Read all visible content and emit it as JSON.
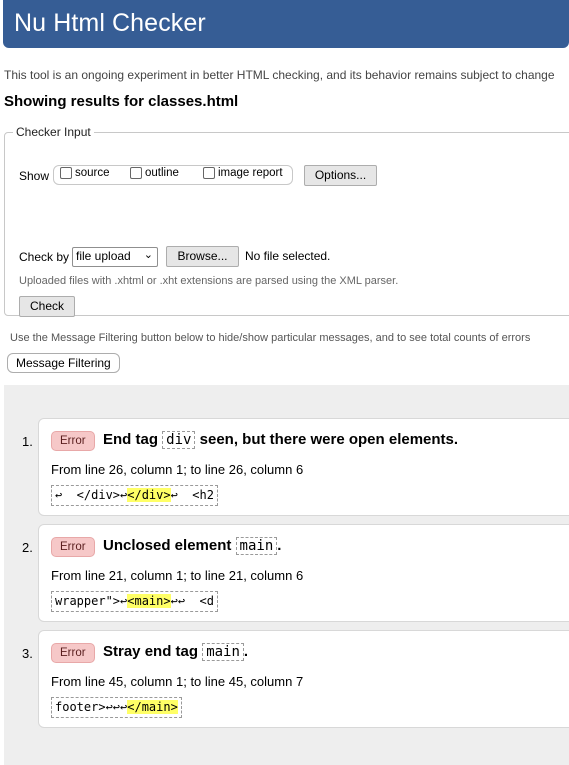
{
  "app_title": "Nu Html Checker",
  "tagline": "This tool is an ongoing experiment in better HTML checking, and its behavior remains subject to change",
  "showing": "Showing results for classes.html",
  "checker_input": {
    "legend": "Checker Input",
    "show_label": "Show",
    "show_options": [
      {
        "label": "source",
        "checked": false
      },
      {
        "label": "outline",
        "checked": false
      },
      {
        "label": "image report",
        "checked": false
      }
    ],
    "options_button": "Options...",
    "check_by_label": "Check by",
    "check_by_value": "file upload",
    "browse_button": "Browse...",
    "no_file": "No file selected.",
    "xml_note": "Uploaded files with .xhtml or .xht extensions are parsed using the XML parser.",
    "check_button": "Check"
  },
  "filter_note": "Use the Message Filtering button below to hide/show particular messages, and to see total counts of errors",
  "message_filtering_button": "Message Filtering",
  "results": [
    {
      "num": "1.",
      "type": "Error",
      "msg_before": "End tag ",
      "msg_code": "div",
      "msg_after": " seen, but there were open elements.",
      "location": "From line 26, column 1; to line 26, column 6",
      "extract_before": "↩  </div>↩",
      "extract_hl": "</div>",
      "extract_after": "↩  <h2"
    },
    {
      "num": "2.",
      "type": "Error",
      "msg_before": "Unclosed element ",
      "msg_code": "main",
      "msg_after": ".",
      "location": "From line 21, column 1; to line 21, column 6",
      "extract_before": "wrapper\">↩",
      "extract_hl": "<main>",
      "extract_after": "↩↩  <d"
    },
    {
      "num": "3.",
      "type": "Error",
      "msg_before": "Stray end tag ",
      "msg_code": "main",
      "msg_after": ".",
      "location": "From line 45, column 1; to line 45, column 7",
      "extract_before": "footer>↩↩↩",
      "extract_hl": "</main>",
      "extract_after": ""
    }
  ],
  "colors": {
    "banner": "#365d95",
    "error_badge": "#f6c8c8",
    "highlight": "#ffff66"
  }
}
